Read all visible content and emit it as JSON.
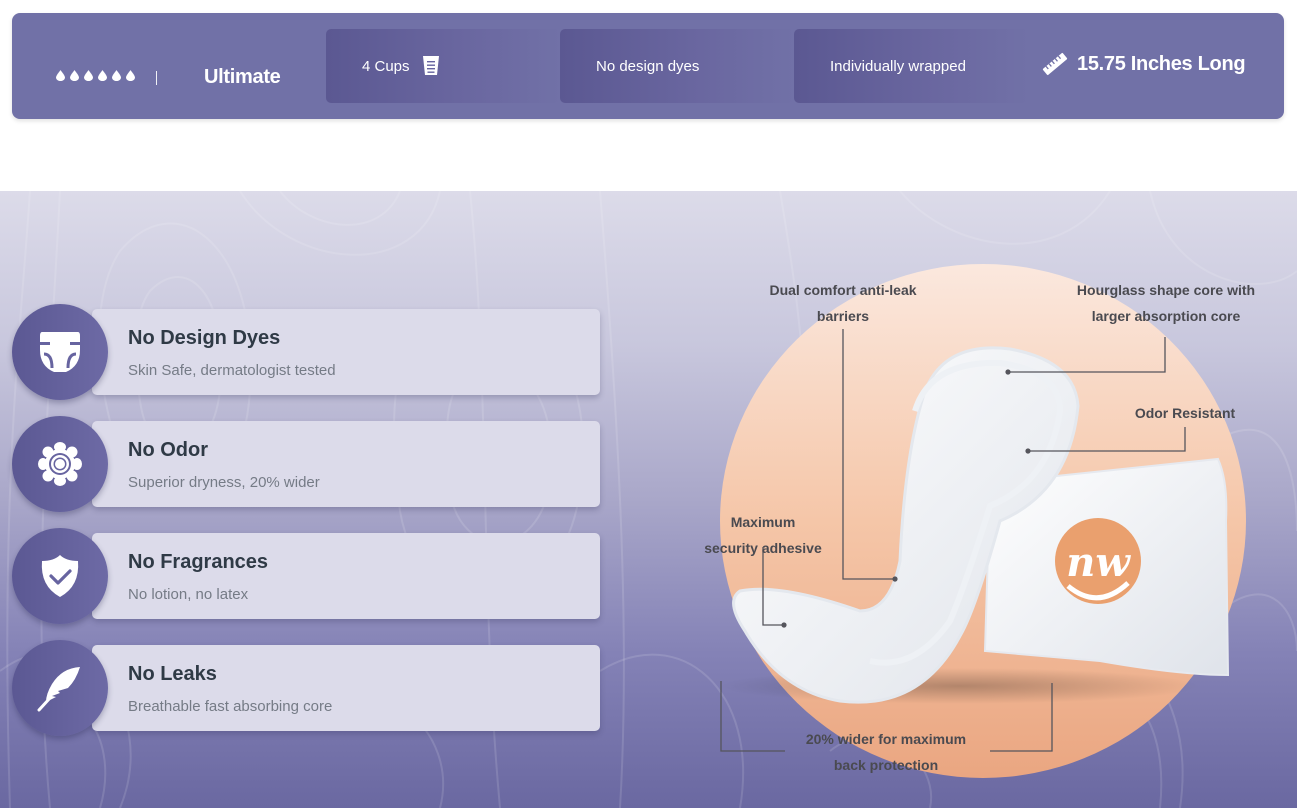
{
  "spec_bar": {
    "absorbency_drops": 6,
    "level": "Ultimate",
    "chips": [
      {
        "label": "4 Cups",
        "icon": "cup-icon"
      },
      {
        "label": "No design dyes"
      },
      {
        "label": "Individually wrapped"
      }
    ],
    "length": {
      "label": "15.75 Inches Long",
      "icon": "ruler-icon"
    }
  },
  "features": [
    {
      "title": "No Design Dyes",
      "subtitle": "Skin Safe, dermatologist tested",
      "icon": "diaper-icon"
    },
    {
      "title": "No Odor",
      "subtitle": "Superior dryness, 20% wider",
      "icon": "flower-icon"
    },
    {
      "title": "No Fragrances",
      "subtitle": "No lotion, no latex",
      "icon": "shield-check-icon"
    },
    {
      "title": "No Leaks",
      "subtitle": "Breathable fast absorbing core",
      "icon": "feather-icon"
    }
  ],
  "callouts": {
    "barriers_l1": "Dual comfort anti-leak",
    "barriers_l2": "barriers",
    "core_l1": "Hourglass shape core with",
    "core_l2": "larger absorption core",
    "odor": "Odor Resistant",
    "adhesive_l1": "Maximum",
    "adhesive_l2": "security adhesive",
    "wider_l1": "20% wider for maximum",
    "wider_l2": "back protection"
  },
  "brand": {
    "logo_text": "nw",
    "logo_color": "#eaa06e"
  },
  "colors": {
    "spec_bar": "#7171a7",
    "chip": "#5b5892",
    "icon_circle": "#5f5c98",
    "card": "#dcdbea",
    "title_text": "#2f3a46",
    "peach": "#f2bf9c"
  }
}
